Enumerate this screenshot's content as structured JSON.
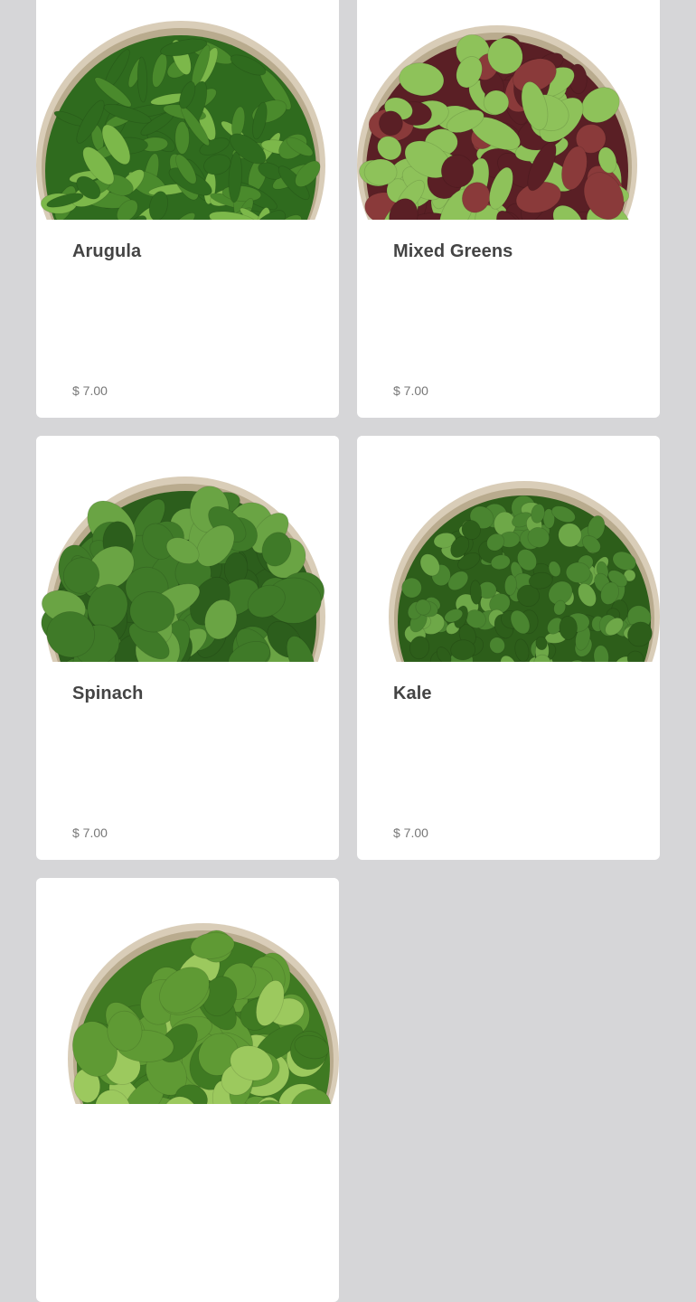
{
  "products": [
    {
      "name": "Arugula",
      "price": "$ 7.00",
      "image_icon": "arugula-bowl-image",
      "colors": {
        "bowl": "#d9cdb8",
        "leaf_dark": "#2f6b1e",
        "leaf_mid": "#4a8a2c",
        "leaf_light": "#7cb84a"
      }
    },
    {
      "name": "Mixed Greens",
      "price": "$ 7.00",
      "image_icon": "mixed-greens-bowl-image",
      "colors": {
        "bowl": "#d9cdb8",
        "leaf_dark": "#5a1f25",
        "leaf_mid": "#8a3a3a",
        "leaf_light": "#8ec25a"
      }
    },
    {
      "name": "Spinach",
      "price": "$ 7.00",
      "image_icon": "spinach-bowl-image",
      "colors": {
        "bowl": "#d9cdb8",
        "leaf_dark": "#2c5e1c",
        "leaf_mid": "#3f7a28",
        "leaf_light": "#6aa444"
      }
    },
    {
      "name": "Kale",
      "price": "$ 7.00",
      "image_icon": "kale-bowl-image",
      "colors": {
        "bowl": "#d9cdb8",
        "leaf_dark": "#2d5e1a",
        "leaf_mid": "#4a8530",
        "leaf_light": "#6ea848"
      }
    },
    {
      "name": "",
      "price": "",
      "image_icon": "lettuce-bowl-image",
      "colors": {
        "bowl": "#d9cdb8",
        "leaf_dark": "#3f7a22",
        "leaf_mid": "#5f9a34",
        "leaf_light": "#9cc95e"
      }
    }
  ]
}
